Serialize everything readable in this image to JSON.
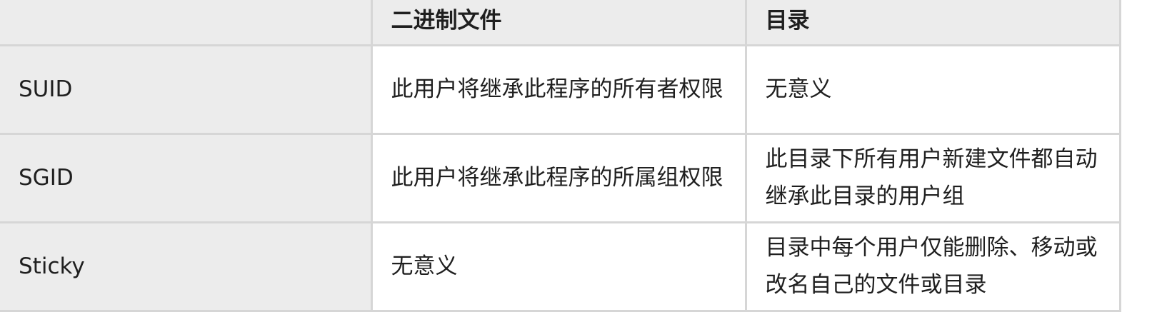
{
  "table": {
    "headers": [
      "",
      "二进制文件",
      "目录"
    ],
    "rows": [
      {
        "name": "SUID",
        "binary": "此用户将继承此程序的所有者权限",
        "directory": "无意义"
      },
      {
        "name": "SGID",
        "binary": "此用户将继承此程序的所属组权限",
        "directory": "此目录下所有用户新建文件都自动继承此目录的用户组"
      },
      {
        "name": "Sticky",
        "binary": "无意义",
        "directory": "目录中每个用户仅能删除、移动或改名自己的文件或目录"
      }
    ]
  }
}
